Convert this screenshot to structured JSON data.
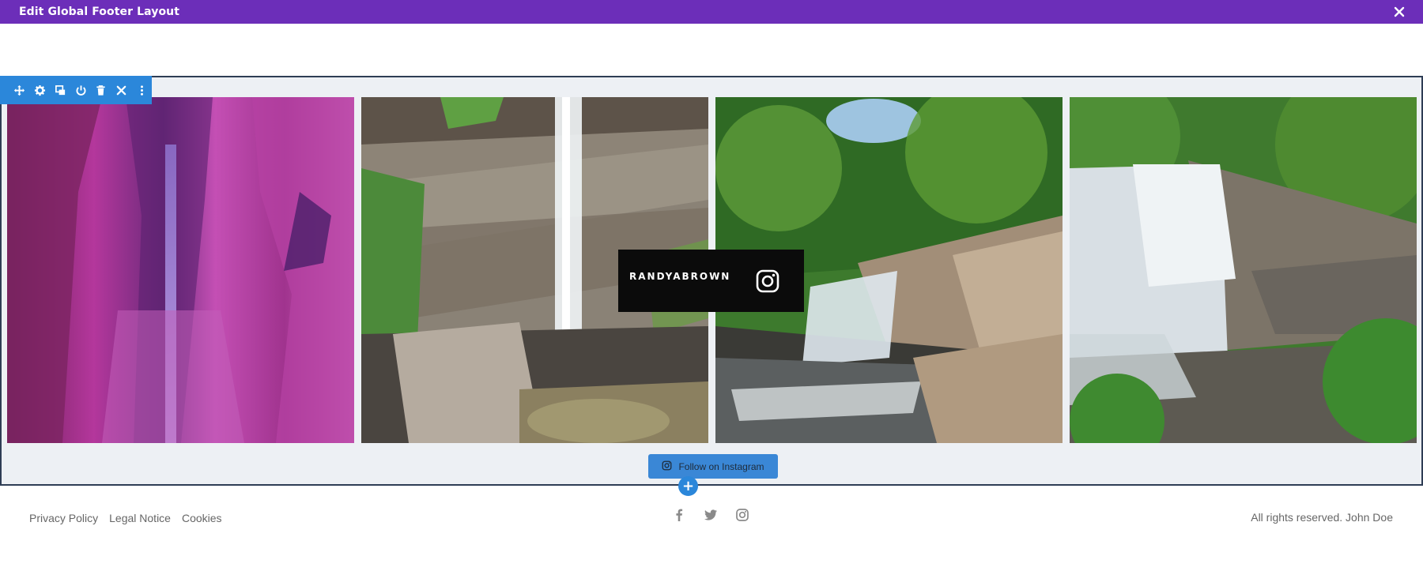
{
  "window": {
    "title": "Edit Global Footer Layout",
    "close_icon": "close-icon",
    "bar_color": "#6c2eb9"
  },
  "toolbar": {
    "color": "#2b87da",
    "buttons": [
      "move-icon",
      "gear-icon",
      "duplicate-icon",
      "power-icon",
      "trash-icon",
      "close-icon",
      "more-vertical-icon"
    ]
  },
  "gallery": {
    "images": [
      {
        "name": "purple-cave-waterfall"
      },
      {
        "name": "cliff-waterfall"
      },
      {
        "name": "forest-cascade"
      },
      {
        "name": "wide-waterfall"
      }
    ],
    "overlay": {
      "username": "RANDYABROWN",
      "icon": "instagram-icon"
    },
    "follow_button": {
      "label": "Follow on Instagram",
      "icon": "instagram-icon"
    },
    "add_button": "+"
  },
  "footer": {
    "links": [
      "Privacy Policy",
      "Legal Notice",
      "Cookies"
    ],
    "social": [
      "facebook-icon",
      "twitter-icon",
      "instagram-icon"
    ],
    "copyright": "All rights reserved. John Doe"
  }
}
